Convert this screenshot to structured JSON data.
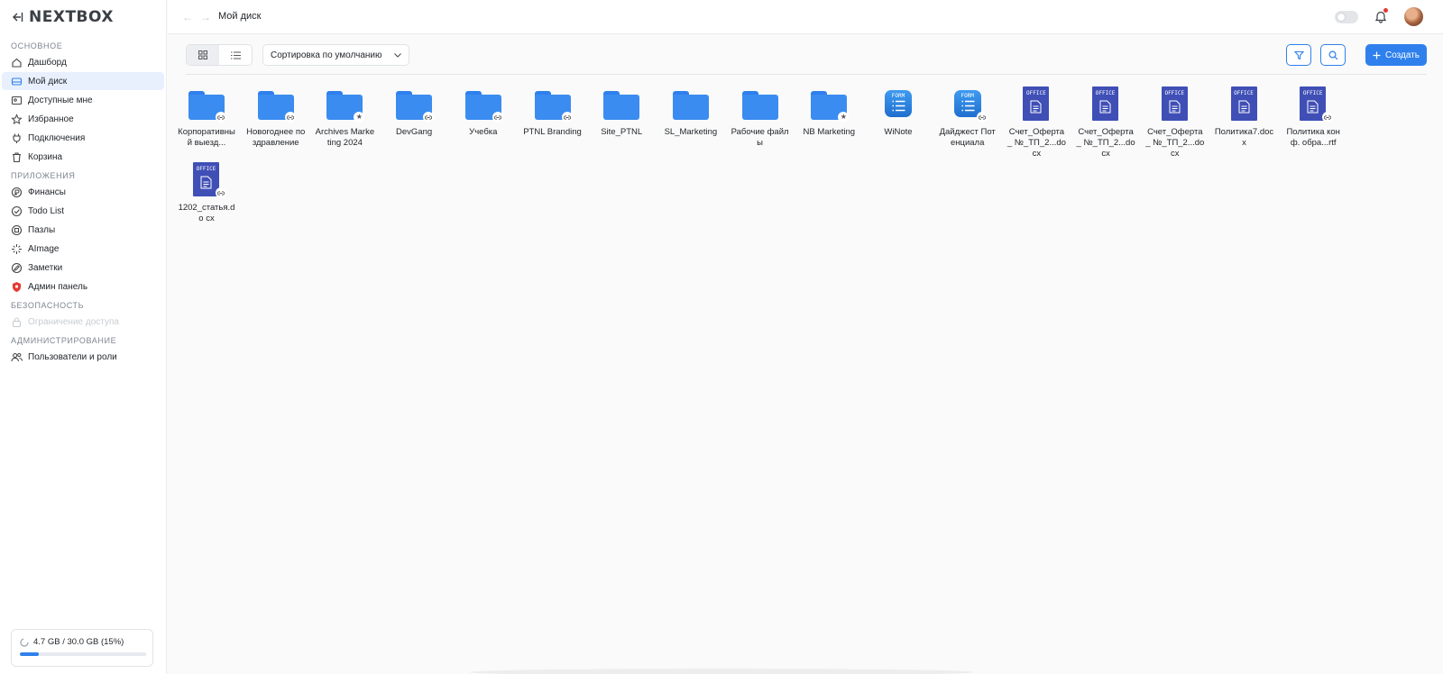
{
  "brand": "NEXTBOX",
  "sidebar": {
    "sections": [
      {
        "title": "ОСНОВНОЕ",
        "items": [
          {
            "label": "Дашборд",
            "icon": "home-icon"
          },
          {
            "label": "Мой диск",
            "icon": "drive-icon",
            "active": true
          },
          {
            "label": "Доступные мне",
            "icon": "shared-icon"
          },
          {
            "label": "Избранное",
            "icon": "star-icon"
          },
          {
            "label": "Подключения",
            "icon": "plug-icon"
          },
          {
            "label": "Корзина",
            "icon": "trash-icon"
          }
        ]
      },
      {
        "title": "ПРИЛОЖЕНИЯ",
        "items": [
          {
            "label": "Финансы",
            "icon": "finance-icon"
          },
          {
            "label": "Todo List",
            "icon": "check-circle-icon"
          },
          {
            "label": "Пазлы",
            "icon": "puzzle-icon"
          },
          {
            "label": "AImage",
            "icon": "sparkle-icon"
          },
          {
            "label": "Заметки",
            "icon": "pen-icon"
          },
          {
            "label": "Админ панель",
            "icon": "shield-icon"
          }
        ]
      },
      {
        "title": "БЕЗОПАСНОСТЬ",
        "items": [
          {
            "label": "Ограничение доступа",
            "icon": "lock-icon",
            "disabled": true
          }
        ]
      },
      {
        "title": "АДМИНИСТРИРОВАНИЕ",
        "items": [
          {
            "label": "Пользователи и роли",
            "icon": "users-icon"
          }
        ]
      }
    ],
    "storage": {
      "text": "4.7 GB / 30.0 GB (15%)",
      "percent": 15
    }
  },
  "header": {
    "breadcrumb": "Мой диск"
  },
  "toolbar": {
    "sort_label": "Сортировка по умолчанию",
    "create_label": "Создать"
  },
  "colors": {
    "accent": "#2f80ed",
    "folder": "#3b8cf0",
    "office": "#3f4fb6"
  },
  "files": [
    {
      "name": "Корпоративны й выезд...",
      "type": "folder",
      "badge": "link"
    },
    {
      "name": "Новогоднее поздравление",
      "type": "folder",
      "badge": "link"
    },
    {
      "name": "Archives Marketing 2024",
      "type": "folder",
      "badge": "star"
    },
    {
      "name": "DevGang",
      "type": "folder",
      "badge": "link"
    },
    {
      "name": "Учебка",
      "type": "folder",
      "badge": "link"
    },
    {
      "name": "PTNL Branding",
      "type": "folder",
      "badge": "link"
    },
    {
      "name": "Site_PTNL",
      "type": "folder",
      "badge": ""
    },
    {
      "name": "SL_Marketing",
      "type": "folder",
      "badge": ""
    },
    {
      "name": "Рабочие файлы",
      "type": "folder",
      "badge": ""
    },
    {
      "name": "NB Marketing",
      "type": "folder",
      "badge": "star"
    },
    {
      "name": "WiNote",
      "type": "form",
      "badge": "",
      "label": "FORM"
    },
    {
      "name": "Дайджест Потенциала",
      "type": "form",
      "badge": "link",
      "label": "FORM"
    },
    {
      "name": "Счет_Оферта_ №_ТП_2...docx",
      "type": "office",
      "badge": "",
      "label": "OFFICE"
    },
    {
      "name": "Счет_Оферта_ №_ТП_2...docx",
      "type": "office",
      "badge": "",
      "label": "OFFICE"
    },
    {
      "name": "Счет_Оферта_ №_ТП_2...docx",
      "type": "office",
      "badge": "",
      "label": "OFFICE"
    },
    {
      "name": "Политика7.doc x",
      "type": "office",
      "badge": "",
      "label": "OFFICE"
    },
    {
      "name": "Политика конф. обра...rtf",
      "type": "office",
      "badge": "link",
      "label": "OFFICE"
    },
    {
      "name": "1202_статья.do cx",
      "type": "office",
      "badge": "link",
      "label": "OFFICE"
    }
  ]
}
